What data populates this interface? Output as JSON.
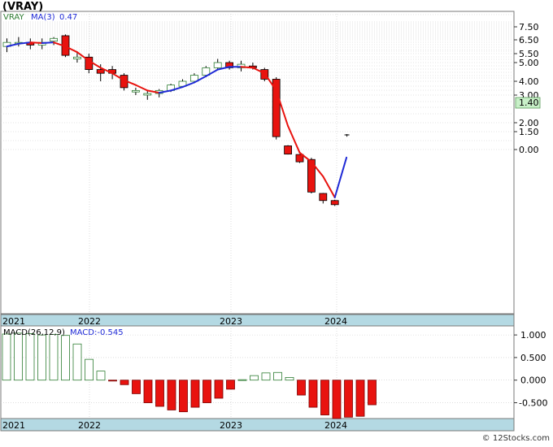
{
  "title": "(VRAY)",
  "footer": "© 12Stocks.com",
  "colors": {
    "up_candle": "#2e7d32",
    "down_candle": "#e8130f",
    "ma_up": "#1f2ad6",
    "ma_down": "#e8130f",
    "macd_pos": "#2e7d32",
    "macd_neg": "#e8130f",
    "axis_bar": "#b4d9e3",
    "price_tag_bg": "#c8f0c8",
    "grid": "#c8c8c8"
  },
  "chart_data": [
    {
      "type": "candlestick",
      "title": "",
      "legend": [
        {
          "label": "VRAY",
          "color": "#2e7d32"
        },
        {
          "label": "MA(3)",
          "color": "#1f2ad6"
        },
        {
          "label": "0.47",
          "color": "#1f2ad6"
        }
      ],
      "y_scale": "log",
      "y_ticks": [
        "7.50",
        "6.50",
        "5.50",
        "5.00",
        "4.00",
        "3.00",
        "2.00",
        "1.50",
        "0.00"
      ],
      "y_tick_values": [
        7.5,
        6.5,
        5.5,
        5.0,
        4.0,
        3.0,
        2.0,
        1.5,
        0.9
      ],
      "last_price_label": "1.40",
      "x_labels": [
        "2021",
        "2022",
        "2023",
        "2024"
      ],
      "grid": true,
      "candles": [
        {
          "open": 6.0,
          "high": 6.6,
          "low": 5.6,
          "close": 6.3
        },
        {
          "open": 6.3,
          "high": 6.7,
          "low": 6.0,
          "close": 6.3
        },
        {
          "open": 6.3,
          "high": 6.6,
          "low": 5.8,
          "close": 6.1
        },
        {
          "open": 6.1,
          "high": 6.6,
          "low": 5.8,
          "close": 6.3
        },
        {
          "open": 6.4,
          "high": 6.7,
          "low": 6.1,
          "close": 6.6
        },
        {
          "open": 6.8,
          "high": 6.9,
          "low": 5.3,
          "close": 5.4
        },
        {
          "open": 5.2,
          "high": 5.6,
          "low": 5.0,
          "close": 5.3
        },
        {
          "open": 5.3,
          "high": 5.5,
          "low": 4.4,
          "close": 4.6
        },
        {
          "open": 4.6,
          "high": 4.9,
          "low": 4.0,
          "close": 4.4
        },
        {
          "open": 4.6,
          "high": 4.8,
          "low": 4.1,
          "close": 4.4
        },
        {
          "open": 4.3,
          "high": 4.4,
          "low": 3.3,
          "close": 3.5
        },
        {
          "open": 3.2,
          "high": 3.5,
          "low": 3.0,
          "close": 3.3
        },
        {
          "open": 3.0,
          "high": 3.3,
          "low": 2.8,
          "close": 3.1
        },
        {
          "open": 3.1,
          "high": 3.4,
          "low": 2.9,
          "close": 3.3
        },
        {
          "open": 3.3,
          "high": 3.8,
          "low": 3.2,
          "close": 3.7
        },
        {
          "open": 3.6,
          "high": 4.1,
          "low": 3.5,
          "close": 4.0
        },
        {
          "open": 4.0,
          "high": 4.4,
          "low": 3.9,
          "close": 4.3
        },
        {
          "open": 4.3,
          "high": 4.8,
          "low": 4.2,
          "close": 4.7
        },
        {
          "open": 4.7,
          "high": 5.2,
          "low": 4.6,
          "close": 5.0
        },
        {
          "open": 5.0,
          "high": 5.1,
          "low": 4.6,
          "close": 4.7
        },
        {
          "open": 4.7,
          "high": 5.1,
          "low": 4.5,
          "close": 4.9
        },
        {
          "open": 4.8,
          "high": 5.0,
          "low": 4.6,
          "close": 4.7
        },
        {
          "open": 4.6,
          "high": 4.7,
          "low": 4.0,
          "close": 4.1
        },
        {
          "open": 4.1,
          "high": 4.2,
          "low": 1.2,
          "close": 1.3
        },
        {
          "open": 1.0,
          "high": 1.02,
          "low": 0.6,
          "close": 0.62
        },
        {
          "open": 0.6,
          "high": 0.62,
          "low": 0.3,
          "close": 0.33
        },
        {
          "open": 0.4,
          "high": 0.46,
          "low": 0.025,
          "close": 0.028
        },
        {
          "open": 0.025,
          "high": 0.026,
          "low": 0.011,
          "close": 0.014
        },
        {
          "open": 0.014,
          "high": 0.015,
          "low": 0.009,
          "close": 0.01
        }
      ],
      "ma": [
        6.0,
        6.2,
        6.3,
        6.25,
        6.3,
        6.0,
        5.6,
        5.1,
        4.7,
        4.4,
        4.05,
        3.7,
        3.3,
        3.15,
        3.3,
        3.55,
        3.9,
        4.25,
        4.6,
        4.75,
        4.75,
        4.7,
        4.4,
        3.3,
        1.8,
        0.7,
        0.33,
        0.1,
        0.018,
        0.47
      ],
      "last_tick": {
        "high": 1.4,
        "low": 1.3
      }
    },
    {
      "type": "bar",
      "title": "",
      "legend": [
        {
          "label": "MACD(26,12,9)",
          "color": "#000000"
        },
        {
          "label": "MACD:-0.545",
          "color": "#1f2ad6"
        }
      ],
      "y_ticks": [
        "1.000",
        "0.500",
        "0.000",
        "-0.500"
      ],
      "y_tick_values": [
        1.0,
        0.5,
        0.0,
        -0.5
      ],
      "ylim": [
        -0.85,
        1.2
      ],
      "x_labels": [
        "2021",
        "2022",
        "2023",
        "2024"
      ],
      "values": [
        1.02,
        1.04,
        1.03,
        1.0,
        1.01,
        0.99,
        0.8,
        0.46,
        0.2,
        -0.02,
        -0.1,
        -0.3,
        -0.5,
        -0.58,
        -0.66,
        -0.7,
        -0.6,
        -0.5,
        -0.4,
        -0.2,
        0.01,
        0.1,
        0.16,
        0.17,
        0.06,
        -0.33,
        -0.6,
        -0.77,
        -0.86,
        -0.82,
        -0.8,
        -0.545
      ]
    }
  ]
}
